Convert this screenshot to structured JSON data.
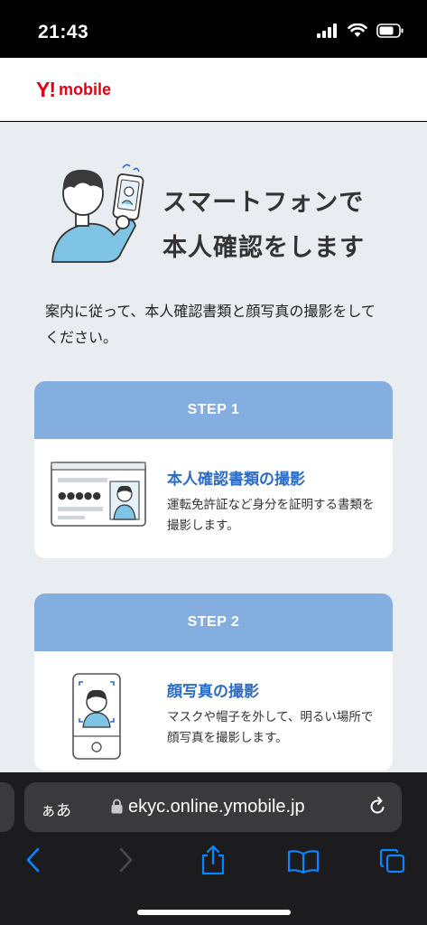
{
  "status_bar": {
    "time": "21:43"
  },
  "header": {
    "logo_y": "Y!",
    "logo_mobile": "mobile"
  },
  "hero": {
    "title_line1": "スマートフォンで",
    "title_line2": "本人確認をします"
  },
  "intro": "案内に従って、本人確認書類と顔写真の撮影をしてください。",
  "steps": [
    {
      "label": "STEP 1",
      "title": "本人確認書類の撮影",
      "desc": "運転免許証など身分を証明する書類を撮影します。"
    },
    {
      "label": "STEP 2",
      "title": "顔写真の撮影",
      "desc": "マスクや帽子を外して、明るい場所で顔写真を撮影します。"
    }
  ],
  "id_card": {
    "masked_number": "●●●●●"
  },
  "browser": {
    "text_size_label": "ぁあ",
    "url": "ekyc.online.ymobile.jp"
  },
  "colors": {
    "brand": "#e60012",
    "step_header": "#84ade0",
    "step_title": "#2c6cc7",
    "background": "#e9edf2",
    "ios_blue": "#0a84ff"
  }
}
